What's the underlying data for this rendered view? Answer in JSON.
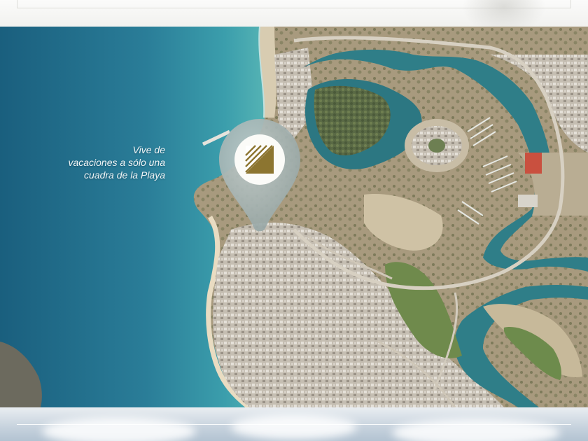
{
  "caption": {
    "line1": "Vive de",
    "line2": "vacaciones a sólo una",
    "line3": "cuadra de la Playa"
  },
  "colors": {
    "ocean_deep": "#1d6c8c",
    "ocean_shallow": "#3a97a8",
    "land": "#b0a186",
    "city": "#c9c3b8",
    "marina_water": "#2f7f8a",
    "pin": "#a6b3b1",
    "logo_gold": "#8c7530"
  },
  "icons": {
    "pin": "map-pin-icon",
    "logo": "development-logo-icon"
  }
}
